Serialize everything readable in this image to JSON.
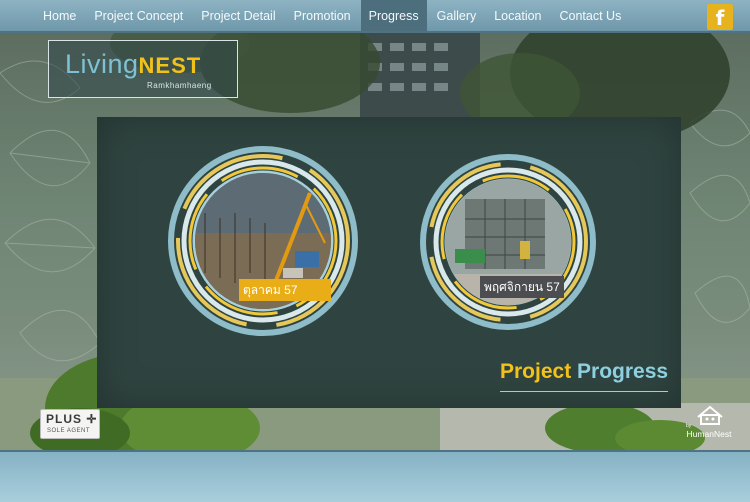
{
  "nav": {
    "items": [
      {
        "label": "Home",
        "active": false
      },
      {
        "label": "Project Concept",
        "active": false
      },
      {
        "label": "Project Detail",
        "active": false
      },
      {
        "label": "Promotion",
        "active": false
      },
      {
        "label": "Progress",
        "active": true
      },
      {
        "label": "Gallery",
        "active": false
      },
      {
        "label": "Location",
        "active": false
      },
      {
        "label": "Contact Us",
        "active": false
      }
    ],
    "social_icon": "facebook-icon",
    "social_glyph": "f"
  },
  "logo": {
    "word_light": "Living",
    "word_bold": "NEST",
    "subtitle": "Ramkhamhaeng"
  },
  "progress": {
    "items": [
      {
        "caption": "ตุลาคม 57"
      },
      {
        "caption": "พฤศจิกายน 57"
      }
    ],
    "title_part1": "Project",
    "title_part2": "Progress"
  },
  "badges": {
    "plus_label": "PLUS",
    "plus_symbol": "✛",
    "plus_sub": "SOLE AGENT",
    "human_by": "by",
    "human_name": "HumanNest"
  },
  "colors": {
    "accent_yellow": "#f2c21b",
    "accent_blue": "#8fd0e0",
    "nav_active": "#4d6e7d"
  }
}
